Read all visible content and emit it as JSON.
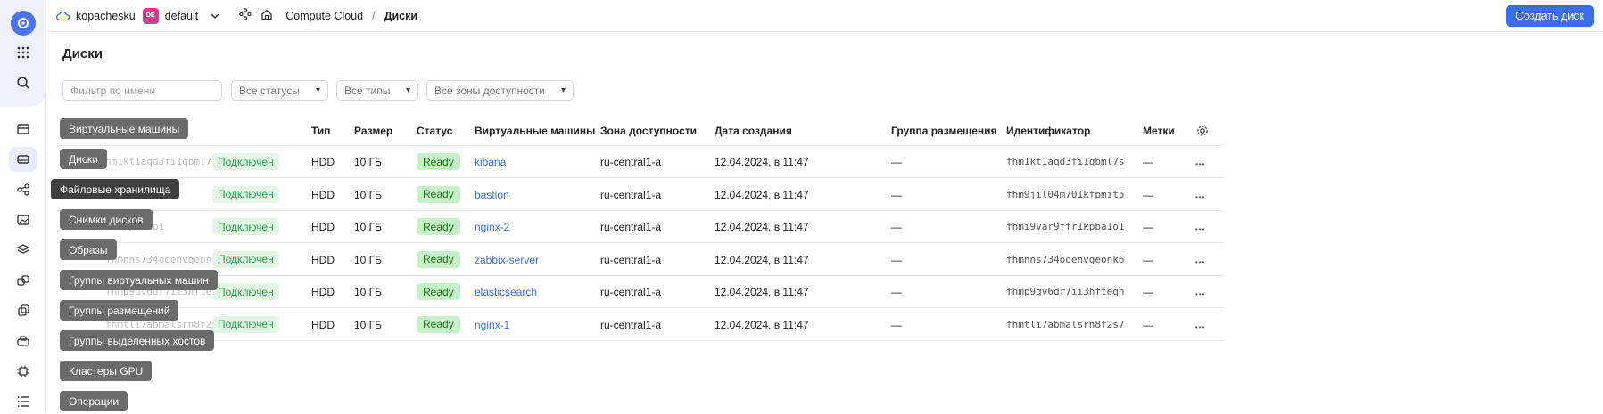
{
  "topbar": {
    "cloud_name": "kopachesku",
    "folder_badge": "DE",
    "folder_name": "default",
    "breadcrumb": [
      "Compute Cloud",
      "Диски"
    ],
    "breadcrumb_sep": "/",
    "create_button": "Создать диск"
  },
  "page": {
    "title": "Диски"
  },
  "filters": {
    "name_placeholder": "Фильтр по имени",
    "status": "Все статусы",
    "type": "Все типы",
    "zone": "Все зоны доступности"
  },
  "table": {
    "headers": [
      "Тип",
      "Размер",
      "Статус",
      "Виртуальные машины",
      "Зона доступности",
      "Дата создания",
      "Группа размещения",
      "Идентификатор",
      "Метки"
    ],
    "rows": [
      {
        "name_tail": "hm1kt1aqd3fi1qbml7s",
        "state": "Подключен",
        "type": "HDD",
        "size": "10 ГБ",
        "status": "Ready",
        "vm": "kibana",
        "zone": "ru-central1-a",
        "created": "12.04.2024, в 11:47",
        "placement": "—",
        "id": "fhm1kt1aqd3fi1qbml7s",
        "labels": "—"
      },
      {
        "name_tail": "kfpmit5",
        "state": "Подключен",
        "type": "HDD",
        "size": "10 ГБ",
        "status": "Ready",
        "vm": "bastion",
        "zone": "ru-central1-a",
        "created": "12.04.2024, в 11:47",
        "placement": "—",
        "id": "fhm9jil04m701kfpmit5",
        "labels": "—"
      },
      {
        "name_tail": "fr1kpba1o1",
        "state": "Подключен",
        "type": "HDD",
        "size": "10 ГБ",
        "status": "Ready",
        "vm": "nginx-2",
        "zone": "ru-central1-a",
        "created": "12.04.2024, в 11:47",
        "placement": "—",
        "id": "fhmi9var9ffr1kpba1o1",
        "labels": "—"
      },
      {
        "name_tail": "fhmnns734ooenvgeonk6",
        "state": "Подключен",
        "type": "HDD",
        "size": "10 ГБ",
        "status": "Ready",
        "vm": "zabbix-server",
        "zone": "ru-central1-a",
        "created": "12.04.2024, в 11:47",
        "placement": "—",
        "id": "fhmnns734ooenvgeonk6",
        "labels": "—"
      },
      {
        "name_tail": "fhmp9gv6dr7ii3hfteqh",
        "state": "Подключен",
        "type": "HDD",
        "size": "10 ГБ",
        "status": "Ready",
        "vm": "elasticsearch",
        "zone": "ru-central1-a",
        "created": "12.04.2024, в 11:47",
        "placement": "—",
        "id": "fhmp9gv6dr7ii3hfteqh",
        "labels": "—"
      },
      {
        "name_tail": "fhmtli7abmalsrn8f2s7",
        "state": "Подключен",
        "type": "HDD",
        "size": "10 ГБ",
        "status": "Ready",
        "vm": "nginx-1",
        "zone": "ru-central1-a",
        "created": "12.04.2024, в 11:47",
        "placement": "—",
        "id": "fhmtli7abmalsrn8f2s7",
        "labels": "—"
      }
    ]
  },
  "nav_tooltips": [
    "Виртуальные машины",
    "Диски",
    "Файловые хранилища",
    "Снимки дисков",
    "Образы",
    "Группы виртуальных машин",
    "Группы размещений",
    "Группы выделенных хостов",
    "Кластеры GPU",
    "Операции"
  ],
  "colors": {
    "accent": "#3a6ee6",
    "folder_badge": "#e5358e",
    "ready_bg": "#c8f0c8",
    "attached_text": "#2ea44f"
  }
}
